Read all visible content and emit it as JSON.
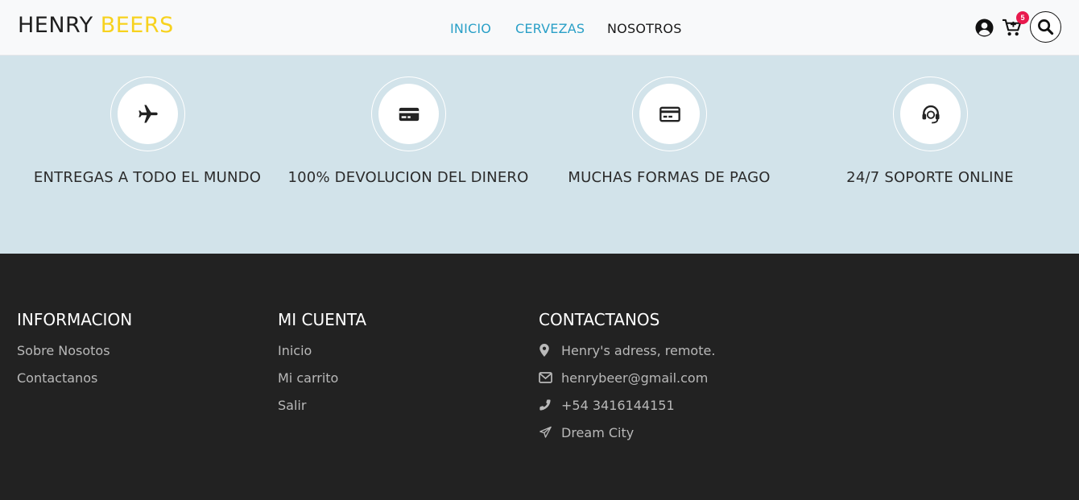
{
  "header": {
    "brand_main": "HENRY",
    "brand_accent": "BEERS",
    "nav": [
      "INICIO",
      "CERVEZAS",
      "NOSOTROS"
    ],
    "cart_count": "5",
    "icons": [
      "user-icon",
      "cart-icon",
      "search-icon"
    ]
  },
  "features": [
    {
      "icon": "airplane-icon",
      "title": "ENTREGAS A TODO EL MUNDO"
    },
    {
      "icon": "credit-card-icon",
      "title": "100% DEVOLUCION DEL DINERO"
    },
    {
      "icon": "payment-card-icon",
      "title": "MUCHAS FORMAS DE PAGO"
    },
    {
      "icon": "headset-icon",
      "title": "24/7 SOPORTE ONLINE"
    }
  ],
  "footer": {
    "informacion": {
      "title": "INFORMACION",
      "links": [
        "Sobre Nosotos",
        "Contactanos"
      ]
    },
    "mi_cuenta": {
      "title": "MI CUENTA",
      "links": [
        "Inicio",
        "Mi carrito",
        "Salir"
      ]
    },
    "contactanos": {
      "title": "CONTACTANOS",
      "items": [
        {
          "icon": "map-pin-icon",
          "text": "Henry's adress, remote."
        },
        {
          "icon": "envelope-icon",
          "text": "henrybeer@gmail.com"
        },
        {
          "icon": "phone-icon",
          "text": "+54 3416144151"
        },
        {
          "icon": "paper-plane-icon",
          "text": "Dream City"
        }
      ]
    }
  },
  "colors": {
    "brand_accent": "#f7d21e",
    "nav_active": "#2aa0c7",
    "features_bg": "#d2e3ea",
    "footer_bg": "#222222",
    "badge": "#e8194d"
  }
}
